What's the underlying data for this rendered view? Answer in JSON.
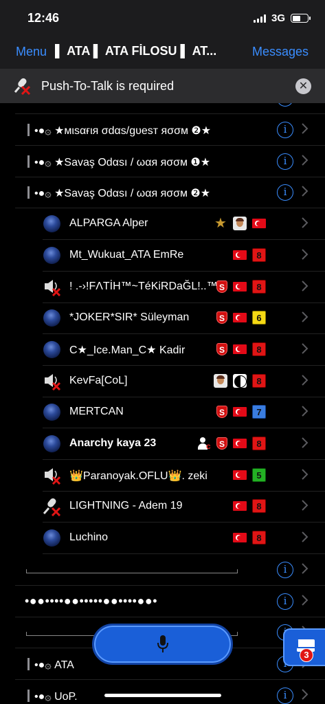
{
  "status": {
    "time": "12:46",
    "network": "3G"
  },
  "nav": {
    "menu_label": "Menu",
    "title": "▌ ATA ▌   ATA FİLOSU   ▌ AT...",
    "messages_label": "Messages"
  },
  "banner": {
    "text": "Push-To-Talk is required",
    "close_icon": "close-icon"
  },
  "channels_top": [
    {
      "name": "•●۞ ★мιѕαғιя σdαs/gυeѕт яσσм ❷★"
    },
    {
      "name": "•●۞ ★Savaş Odαsı /  ωαя яσσм ❶★"
    },
    {
      "name": "•●۞ ★Savaş Odαsı /  ωαя яσσм ❷★"
    }
  ],
  "users": [
    {
      "name": "ALPARGA Alper",
      "state": "normal",
      "bold": false,
      "badges": [
        "star",
        "face",
        "flag"
      ]
    },
    {
      "name": "Mt_Wukuat_ATA EmRe",
      "state": "normal",
      "bold": false,
      "badges": [
        "flag",
        "num-red:8"
      ]
    },
    {
      "name": "!   .-›!FΛTİH™~TéKiRDaĞL!..™ »",
      "state": "muted",
      "bold": false,
      "badges": [
        "shield",
        "flag",
        "num-red:8"
      ]
    },
    {
      "name": "*JOKER*SIR* Süleyman",
      "state": "normal",
      "bold": false,
      "badges": [
        "shield",
        "flag",
        "num-yellow:6"
      ]
    },
    {
      "name": "C★_Ice.Man_C★ Kadir",
      "state": "normal",
      "bold": false,
      "badges": [
        "shield",
        "flag",
        "num-red:8"
      ]
    },
    {
      "name": "KevFa[CoL]",
      "state": "muted",
      "bold": false,
      "badges": [
        "face",
        "yin",
        "num-red:8"
      ]
    },
    {
      "name": "MERTCAN",
      "state": "normal",
      "bold": false,
      "badges": [
        "shield",
        "flag",
        "num-blue:7"
      ]
    },
    {
      "name": "Anarchy kaya 23",
      "state": "normal",
      "bold": true,
      "badges": [
        "person",
        "shield",
        "flag",
        "num-red:8"
      ]
    },
    {
      "name": "👑Paranoyak.OFLU👑. zeki",
      "state": "muted",
      "bold": false,
      "badges": [
        "flag",
        "num-green:5"
      ]
    },
    {
      "name": "LIGHTNING - Adem 19",
      "state": "ptt",
      "bold": false,
      "badges": [
        "flag",
        "num-red:8"
      ]
    },
    {
      "name": "Luchino",
      "state": "normal",
      "bold": false,
      "badges": [
        "flag",
        "num-red:8"
      ]
    }
  ],
  "channels_bottom": [
    {
      "name": "",
      "kind": "line"
    },
    {
      "name": "•●●••••●●•••••●●••••●●•",
      "kind": "dots"
    },
    {
      "name": "",
      "kind": "line"
    },
    {
      "name": "•●۞ ATA",
      "kind": "normal"
    },
    {
      "name": "•●۞ UoP.",
      "kind": "normal"
    }
  ],
  "messages_badge": {
    "count": "3"
  },
  "colors": {
    "accent": "#3a8dff",
    "talk_button": "#1a5fd8",
    "background": "#000000"
  }
}
